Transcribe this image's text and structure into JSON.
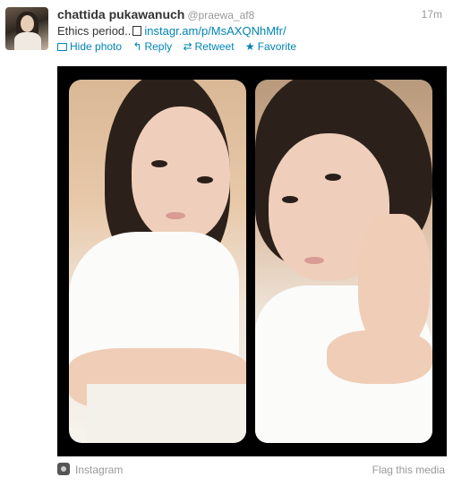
{
  "tweet": {
    "author_name": "chattida pukawanuch",
    "author_handle": "@praewa_af8",
    "timestamp": "17m",
    "text_prefix": "Ethics period..",
    "link_text": "instagr.am/p/MsAXQNhMfr/"
  },
  "actions": {
    "hide_photo": "Hide photo",
    "reply": "Reply",
    "retweet": "Retweet",
    "favorite": "Favorite"
  },
  "icons": {
    "hide_photo": "photo-icon",
    "reply": "reply-arrow-icon",
    "retweet": "retweet-icon",
    "favorite": "star-icon",
    "source": "instagram-icon"
  },
  "media_footer": {
    "source": "Instagram",
    "flag": "Flag this media"
  },
  "colors": {
    "link": "#0084b4",
    "muted": "#999999",
    "media_bg": "#000000"
  }
}
